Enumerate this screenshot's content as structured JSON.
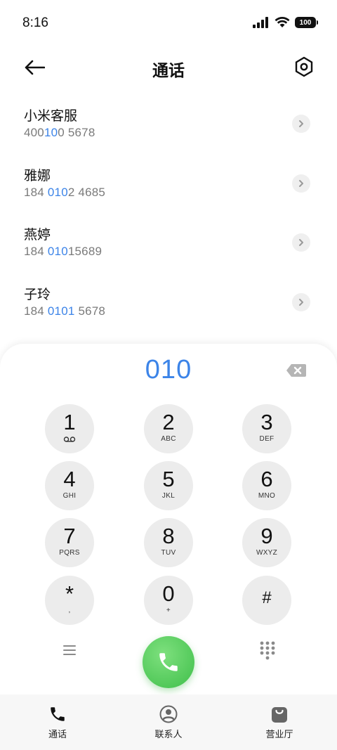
{
  "status_bar": {
    "time": "8:16",
    "battery": "100"
  },
  "header": {
    "title": "通话"
  },
  "contacts": [
    {
      "name": "小米客服",
      "number_parts": [
        "400",
        "10",
        "0 5678"
      ]
    },
    {
      "name": "雅娜",
      "number_parts": [
        "184 ",
        "010",
        "2 4685"
      ]
    },
    {
      "name": "燕婷",
      "number_parts": [
        "184 ",
        "010",
        "15689"
      ]
    },
    {
      "name": "子玲",
      "number_parts": [
        "184 ",
        "0101",
        " 5678"
      ]
    }
  ],
  "dialer": {
    "input": "010",
    "keys": [
      {
        "digit": "1",
        "sub": "voicemail"
      },
      {
        "digit": "2",
        "sub": "ABC"
      },
      {
        "digit": "3",
        "sub": "DEF"
      },
      {
        "digit": "4",
        "sub": "GHI"
      },
      {
        "digit": "5",
        "sub": "JKL"
      },
      {
        "digit": "6",
        "sub": "MNO"
      },
      {
        "digit": "7",
        "sub": "PQRS"
      },
      {
        "digit": "8",
        "sub": "TUV"
      },
      {
        "digit": "9",
        "sub": "WXYZ"
      },
      {
        "digit": "*",
        "sub": ","
      },
      {
        "digit": "0",
        "sub": "+"
      },
      {
        "digit": "#",
        "sub": ""
      }
    ]
  },
  "tabs": [
    {
      "label": "通话",
      "icon": "phone-icon",
      "active": true
    },
    {
      "label": "联系人",
      "icon": "person-icon",
      "active": false
    },
    {
      "label": "营业厅",
      "icon": "shopping-bag-icon",
      "active": false
    }
  ],
  "colors": {
    "accent": "#3c84e8",
    "call_green": "#4cc456",
    "key_bg": "#ececec"
  }
}
